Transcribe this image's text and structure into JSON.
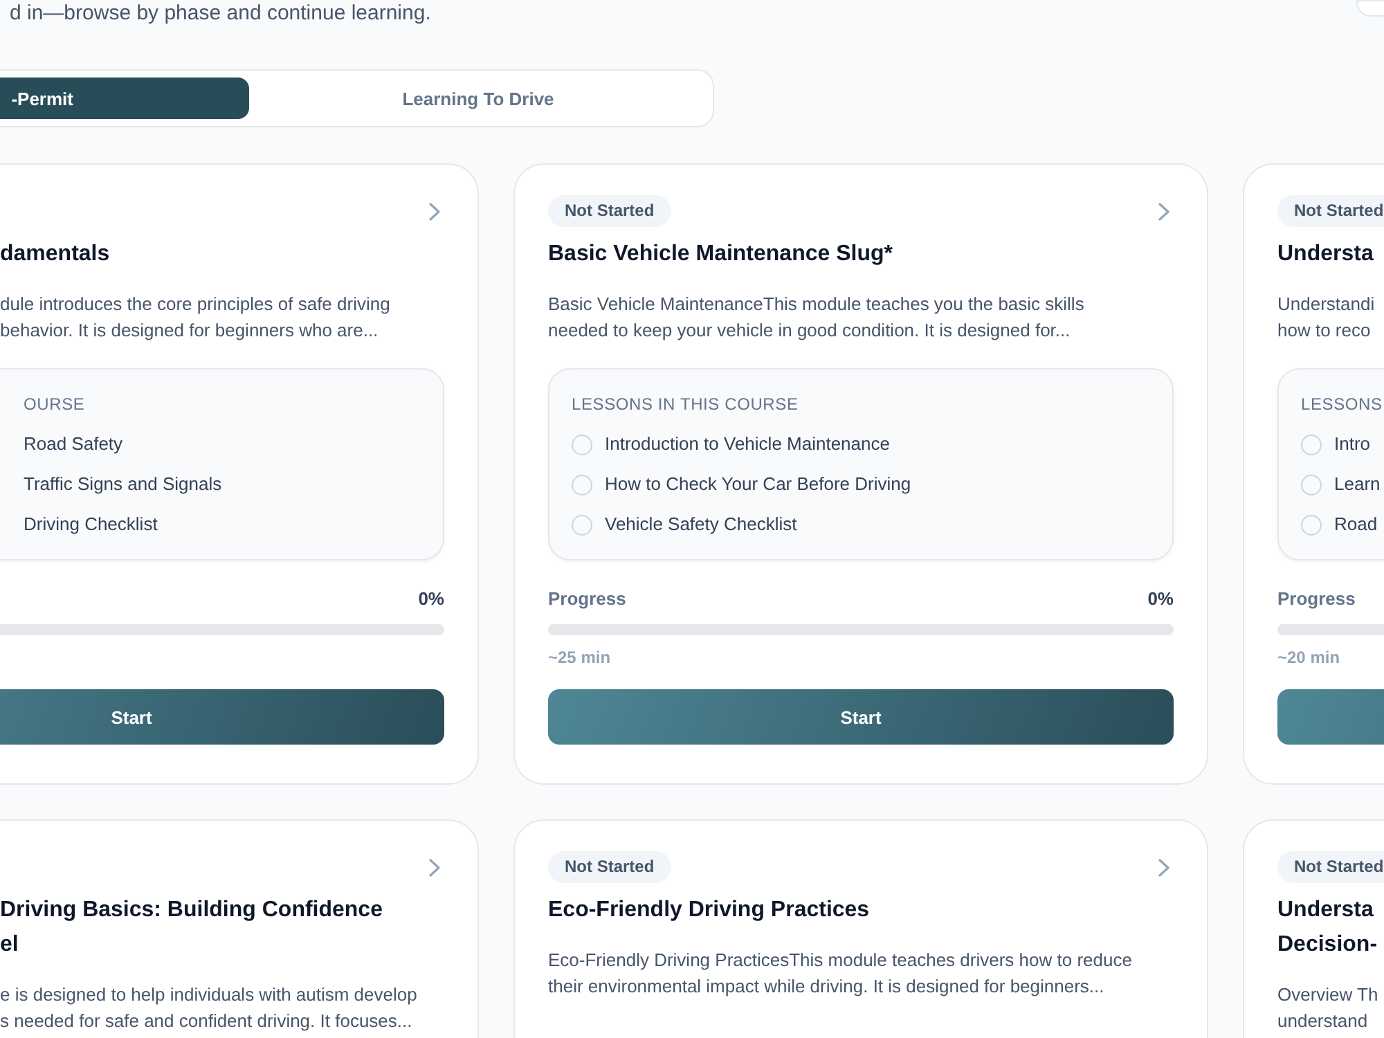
{
  "header": {
    "subtitle": "d in—browse by phase and continue learning."
  },
  "tabs": [
    {
      "label": "-Permit",
      "selected": true
    },
    {
      "label": "Learning To Drive",
      "selected": false
    }
  ],
  "modules": [
    {
      "title": "damentals",
      "description": "dule introduces the core principles of safe driving\nbehavior. It is designed for beginners who are...",
      "lessons_heading": "OURSE",
      "lessons": [
        "Road Safety",
        "Traffic Signs and Signals",
        "Driving Checklist"
      ],
      "progress_value": "0%",
      "level": 0,
      "action": "Start"
    },
    {
      "status": "Not Started",
      "title": "Basic Vehicle Maintenance Slug*",
      "description": "Basic Vehicle MaintenanceThis module teaches you the basic skills\nneeded to keep your vehicle in good condition. It is designed for...",
      "lessons_heading": "LESSONS IN THIS COURSE",
      "lessons": [
        "Introduction to Vehicle Maintenance",
        "How to Check Your Car Before Driving",
        "Vehicle Safety Checklist"
      ],
      "progress_label": "Progress",
      "progress_value": "0%",
      "level": 0,
      "duration": "~25 min",
      "action": "Start"
    },
    {
      "status": "Not Started",
      "title": "Understa",
      "description": "Understandi\nhow to reco",
      "lessons_heading": "LESSONS",
      "lessons": [
        "Intro",
        "Learn",
        "Road"
      ],
      "progress_label": "Progress",
      "level": 0,
      "duration": "~20 min"
    },
    {
      "title": "Driving Basics: Building Confidence\nel",
      "description": "e is designed to help individuals with autism develop\ns needed for safe and confident driving. It focuses..."
    },
    {
      "status": "Not Started",
      "title": "Eco-Friendly Driving Practices",
      "description": "Eco-Friendly Driving PracticesThis module teaches drivers how to reduce\ntheir environmental impact while driving. It is designed for beginners..."
    },
    {
      "status": "Not Started",
      "title": "Understa\nDecision-",
      "description": "Overview Th\nunderstand"
    }
  ]
}
